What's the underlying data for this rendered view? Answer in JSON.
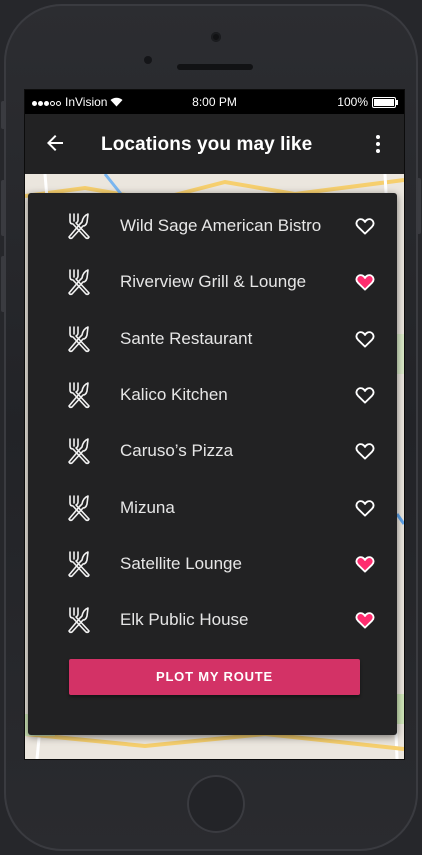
{
  "status_bar": {
    "carrier": "InVision",
    "time": "8:00 PM",
    "battery": "100%"
  },
  "app_bar": {
    "title": "Locations you may like",
    "back_icon": "arrow-back-icon",
    "menu_icon": "more-vert-icon"
  },
  "colors": {
    "accent": "#d33266",
    "heart_active": "#ff2d6f",
    "card": "#222223",
    "text": "#e6e6e6"
  },
  "restaurants": [
    {
      "name": "Wild Sage American Bistro",
      "favorite": false,
      "icon": "fork-knife-icon"
    },
    {
      "name": "Riverview Grill & Lounge",
      "favorite": true,
      "icon": "fork-knife-icon"
    },
    {
      "name": "Sante Restaurant",
      "favorite": false,
      "icon": "fork-knife-icon"
    },
    {
      "name": "Kalico Kitchen",
      "favorite": false,
      "icon": "fork-knife-icon"
    },
    {
      "name": "Caruso’s Pizza",
      "favorite": false,
      "icon": "fork-knife-icon"
    },
    {
      "name": "Mizuna",
      "favorite": false,
      "icon": "fork-knife-icon"
    },
    {
      "name": "Satellite Lounge",
      "favorite": true,
      "icon": "fork-knife-icon"
    },
    {
      "name": "Elk Public House",
      "favorite": true,
      "icon": "fork-knife-icon"
    }
  ],
  "cta": {
    "label": "PLOT MY ROUTE"
  }
}
